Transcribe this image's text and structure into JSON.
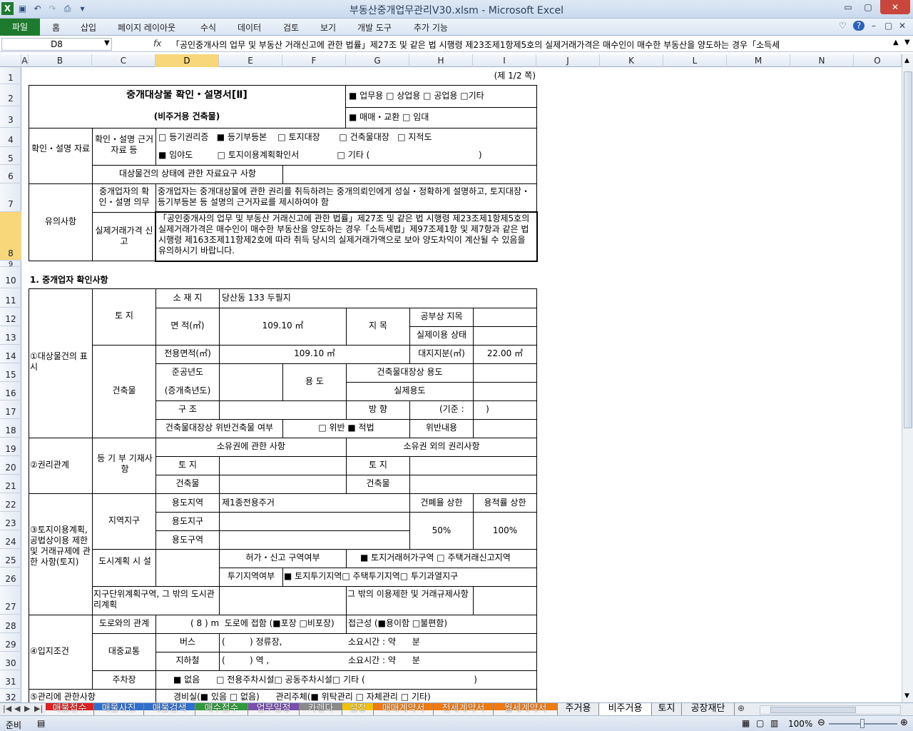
{
  "window": {
    "title": "부동산중개업무관리V30.xlsm  -  Microsoft Excel",
    "controls": [
      "▭",
      "▢",
      "✕"
    ]
  },
  "ribbon": {
    "file_tab": "파일",
    "tabs": [
      "홈",
      "삽입",
      "페이지 레이아웃",
      "수식",
      "데이터",
      "검토",
      "보기",
      "개발 도구",
      "추가 기능"
    ]
  },
  "formula_bar": {
    "name_box": "D8",
    "fx": "fx",
    "content": "「공인중개사의 업무 및 부동산 거래신고에 관한 법률」제27조 및 같은 법 시행령 제23조제1항제5호의 실제거래가격은 매수인이 매수한 부동산을 양도하는 경우「소득세"
  },
  "columns": [
    "A",
    "B",
    "C",
    "D",
    "E",
    "F",
    "G",
    "H",
    "I",
    "J",
    "K",
    "L",
    "M",
    "N",
    "O"
  ],
  "selected_column": "D",
  "rows": [
    "1",
    "2",
    "3",
    "4",
    "5",
    "6",
    "7",
    "8",
    "9",
    "10",
    "11",
    "12",
    "13",
    "14",
    "15",
    "16",
    "17",
    "18",
    "19",
    "20",
    "21",
    "22",
    "23",
    "24",
    "25",
    "26",
    "27",
    "28",
    "29",
    "30",
    "31",
    "32"
  ],
  "selected_row": "8",
  "form": {
    "page_no": "(제 1/2 쪽)",
    "title": "중개대상물 확인・설명서[Ⅱ]",
    "subtitle": "(비주거용 건축물)",
    "usage_options": "■ 업무용  □ 상업용  □ 공업용  □기타",
    "deal_options": "■ 매매・교환   □ 임대",
    "confirm_label": "확인・설명 자료",
    "basis_label": "확인・설명 근거자료 등",
    "basis_line1": "□ 등기권리증   ■ 등기부등본    □ 토지대장       □ 건축물대장   □ 지적도",
    "basis_line2": "■ 임야도         □ 토지이용계획확인서              □ 기타 (                                        )",
    "status_label": "대상물건의 상태에 관한 자료요구 사항",
    "notice_label": "유의사항",
    "duty_label": "중개업자의 확인・설명 의무",
    "duty_text": "중개업자는 중개대상물에 관한 권리를 취득하려는 중개의뢰인에게 성실・정확하게 설명하고, 토지대장・등기부등본 등 설명의 근거자료를 제시하여야 함",
    "price_label": "실제거래가격 신고",
    "price_text": "「공인중개사의 업무 및 부동산 거래신고에 관한 법률」제27조 및 같은 법 시행령 제23조제1항제5호의 실제거래가격은 매수인이 매수한 부동산을 양도하는 경우「소득세법」제97조제1항 및 제7항과 같은 법 시행령 제163조제11항제2호에 따라 취득 당시의 실제거래가액으로 보아 양도차익이 계산될 수 있음을 유의하시기 바랍니다.",
    "section1": "1. 중개업자 확인사항",
    "s1_label": "①대상물건의 표시",
    "land": "토 지",
    "location_label": "소 재 지",
    "location_value": "당산동 133 두필지",
    "area_label": "면 적(㎡)",
    "area_value": "109.10 ㎡",
    "jimok_label": "지 목",
    "official_jimok": "공부상 지목",
    "actual_use_status": "실제이용 상태",
    "building": "건축물",
    "exclusive_area_label": "전용면적(㎡)",
    "exclusive_area_value": "109.10 ㎡",
    "land_share_label": "대지지분(㎡)",
    "land_share_value": "22.00 ㎡",
    "completion_year": "준공년도",
    "remodel_year": "(증개축년도)",
    "use_label": "용 도",
    "ledger_use": "건축물대장상 용도",
    "actual_use": "실제용도",
    "structure_label": "구 조",
    "direction_label": "방 향",
    "direction_value": "(기준 :        )",
    "violation_label": "건축물대장상 위반건축물 여부",
    "violation_value": "□ 위반 ■ 적법",
    "violation_detail": "위반내용",
    "s2_label": "②권리관계",
    "registry_label": "등 기 부 기재사항",
    "ownership_label": "소유권에 관한 사항",
    "other_rights_label": "소유권 외의 권리사항",
    "s3_label": "③토지이용계획, 공법상이용 제한 및 거래규제에 관한 사항(토지)",
    "zoning_label": "지역지구",
    "use_area": "용도지역",
    "use_area_value": "제1종전용주거",
    "use_district": "용도지구",
    "use_zone": "용도구역",
    "bcr_label": "건폐율 상한",
    "far_label": "용적률 상한",
    "bcr_value": "50%",
    "far_value": "100%",
    "urban_plan": "도시계획 시 설",
    "permit_zone_label": "허가・신고 구역여부",
    "permit_zone_value": "■ 토지거래허가구역 □ 주택거래신고지역",
    "spec_zone_label": "투기지역여부",
    "spec_zone_value": "■ 토지투기지역□ 주택투기지역□ 투기과열지구",
    "district_plan": "지구단위계획구역, 그 밖의 도시관리계획",
    "other_restrict": "그 밖의 이용제한 및 거래규제사항",
    "s4_label": "④입지조건",
    "road_label": "도로와의 관계",
    "road_value": "( 8 ) m  도로에 접함 (■포장 □비포장)",
    "access_value": "접근성 (■용이함 □불편함)",
    "transit_label": "대중교통",
    "bus_label": "버스",
    "bus_value": "(         ) 정류장,",
    "subway_label": "지하철",
    "subway_value": "(         ) 역 ,",
    "time_value": "소요시간 : 약      분",
    "parking_label": "주차장",
    "parking_value": "■ 없음      □ 전용주차시설□ 공동주차시설□ 기타 (                                        )",
    "s5_label": "⑤관리에 관한사항",
    "mgmt_value": "경비실(■ 있음 □ 없음)      관리주체(■ 위탁관리 □ 자체관리 □ 기타)"
  },
  "sheet_tabs": [
    {
      "label": "매물접수",
      "color": "#e02020"
    },
    {
      "label": "매물사진",
      "color": "#2f6fd0"
    },
    {
      "label": "매물검색",
      "color": "#2f6fd0"
    },
    {
      "label": "매수접수",
      "color": "#2e9a3a"
    },
    {
      "label": "업무일정",
      "color": "#7a4fb0"
    },
    {
      "label": "카렌다",
      "color": "#8a8a8a"
    },
    {
      "label": "설정",
      "color": "#f2c200"
    },
    {
      "label": "매매계약서",
      "color": "#f07a10"
    },
    {
      "label": "전세계약서",
      "color": "#f07a10"
    },
    {
      "label": "월세계약서",
      "color": "#f07a10"
    },
    {
      "label": "주거용",
      "color": ""
    },
    {
      "label": "비주거용",
      "color": ""
    },
    {
      "label": "토지",
      "color": ""
    },
    {
      "label": "공장재단",
      "color": ""
    }
  ],
  "active_tab": "비주거용",
  "status": {
    "ready": "준비",
    "zoom": "100%"
  }
}
